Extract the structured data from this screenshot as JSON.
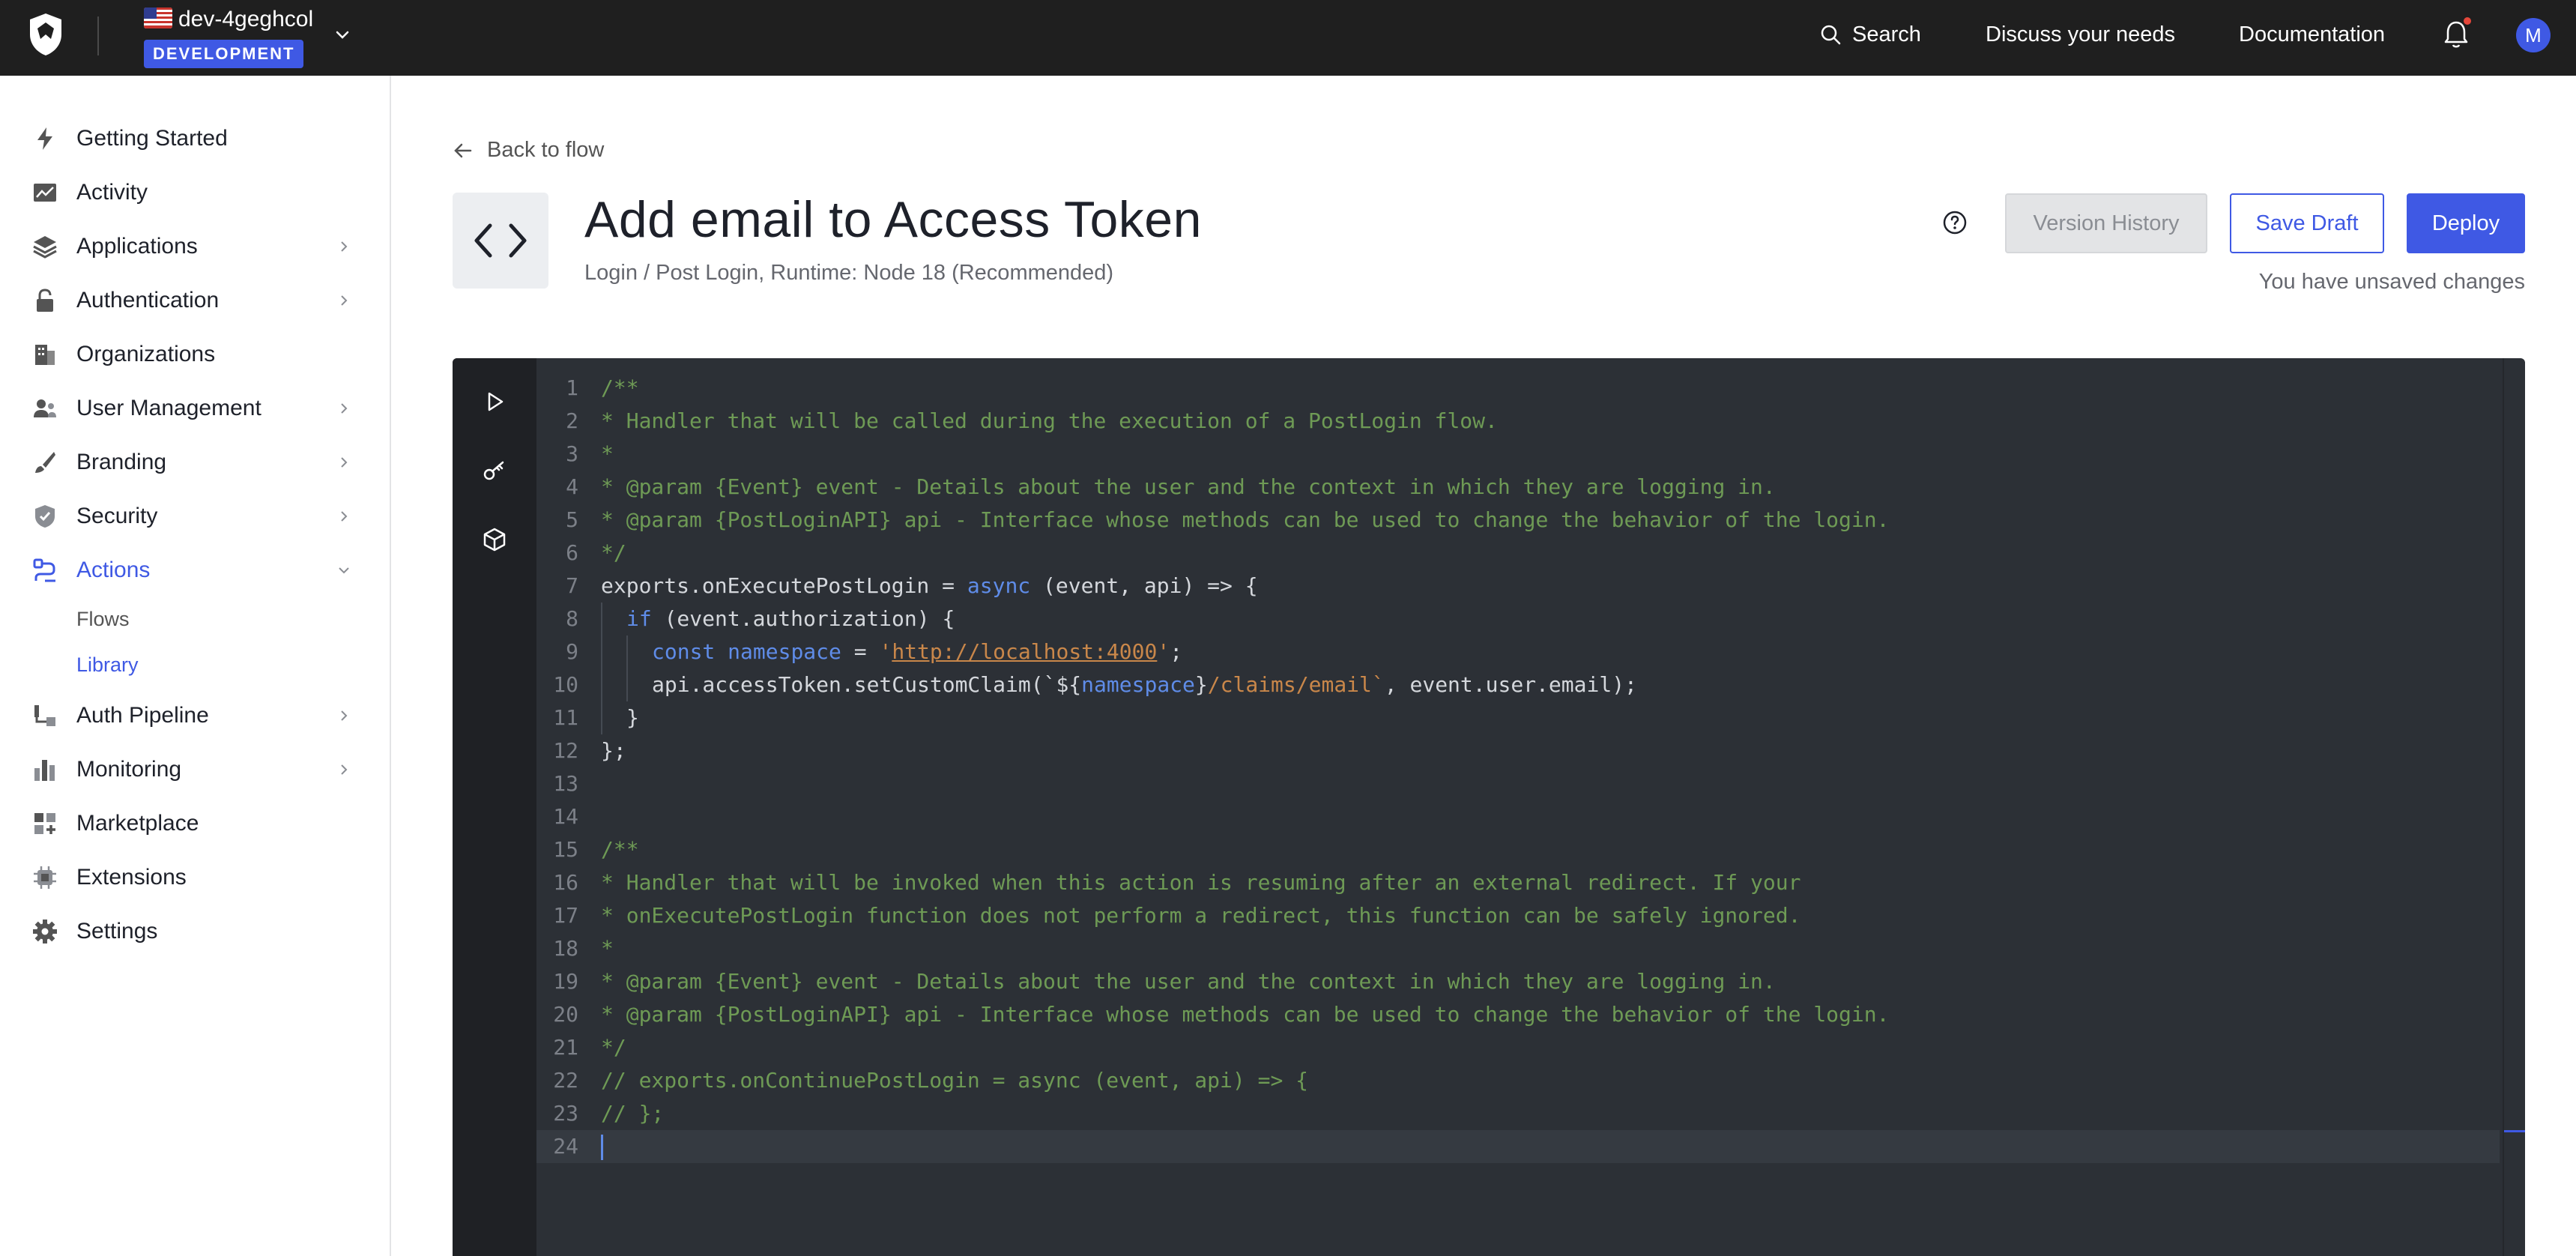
{
  "topbar": {
    "tenant_name": "dev-4geghcol",
    "env_badge": "DEVELOPMENT",
    "search_label": "Search",
    "discuss_label": "Discuss your needs",
    "docs_label": "Documentation",
    "avatar_initial": "M"
  },
  "sidebar": {
    "items": [
      {
        "label": "Getting Started",
        "icon": "bolt-icon"
      },
      {
        "label": "Activity",
        "icon": "chart-line-icon"
      },
      {
        "label": "Applications",
        "icon": "layers-icon"
      },
      {
        "label": "Authentication",
        "icon": "lock-icon"
      },
      {
        "label": "Organizations",
        "icon": "building-icon"
      },
      {
        "label": "User Management",
        "icon": "users-icon"
      },
      {
        "label": "Branding",
        "icon": "brush-icon"
      },
      {
        "label": "Security",
        "icon": "shield-icon"
      },
      {
        "label": "Actions",
        "icon": "actions-flow-icon"
      },
      {
        "label": "Auth Pipeline",
        "icon": "pipeline-icon"
      },
      {
        "label": "Monitoring",
        "icon": "bar-chart-icon"
      },
      {
        "label": "Marketplace",
        "icon": "grid-plus-icon"
      },
      {
        "label": "Extensions",
        "icon": "chip-icon"
      },
      {
        "label": "Settings",
        "icon": "gear-icon"
      }
    ],
    "actions_sub": [
      {
        "label": "Flows"
      },
      {
        "label": "Library"
      }
    ]
  },
  "page": {
    "back_label": "Back to flow",
    "title": "Add email to Access Token",
    "subtitle": "Login / Post Login, Runtime: Node 18 (Recommended)",
    "version_history_label": "Version History",
    "save_draft_label": "Save Draft",
    "deploy_label": "Deploy",
    "unsaved_label": "You have unsaved changes"
  },
  "editor": {
    "line_numbers": [
      "1",
      "2",
      "3",
      "4",
      "5",
      "6",
      "7",
      "8",
      "9",
      "10",
      "11",
      "12",
      "13",
      "14",
      "15",
      "16",
      "17",
      "18",
      "19",
      "20",
      "21",
      "22",
      "23",
      "24"
    ],
    "lines": {
      "l1": "/**",
      "l2": "* Handler that will be called during the execution of a PostLogin flow.",
      "l3": "*",
      "l4": "* @param {Event} event - Details about the user and the context in which they are logging in.",
      "l5": "* @param {PostLoginAPI} api - Interface whose methods can be used to change the behavior of the login.",
      "l6": "*/",
      "l7a": "exports.onExecutePostLogin = ",
      "l7b": "async",
      "l7c": " (event, api) => {",
      "l8a": "if",
      "l8b": " (event.authorization) {",
      "l9a": "const",
      "l9b": "namespace",
      "l9c": " = ",
      "l9d": "'",
      "l9e": "http://localhost:4000",
      "l9f": "'",
      "l9g": ";",
      "l10a": "api.accessToken.setCustomClaim(",
      "l10b": "`${",
      "l10c": "namespace",
      "l10d": "}",
      "l10e": "/claims/email`",
      "l10f": ", event.user.email);",
      "l11": "}",
      "l12": "};",
      "l15": "/**",
      "l16": "* Handler that will be invoked when this action is resuming after an external redirect. If your",
      "l17": "* onExecutePostLogin function does not perform a redirect, this function can be safely ignored.",
      "l18": "*",
      "l19": "* @param {Event} event - Details about the user and the context in which they are logging in.",
      "l20": "* @param {PostLoginAPI} api - Interface whose methods can be used to change the behavior of the login.",
      "l21": "*/",
      "l22": "// exports.onContinuePostLogin = async (event, api) => {",
      "l23": "// };"
    }
  },
  "colors": {
    "brand": "#3f59e4",
    "topbar_bg": "#1f1f1f",
    "editor_bg": "#2c3036",
    "comment": "#6e9a55",
    "keyword": "#5f8ce8",
    "string": "#c9874a"
  }
}
